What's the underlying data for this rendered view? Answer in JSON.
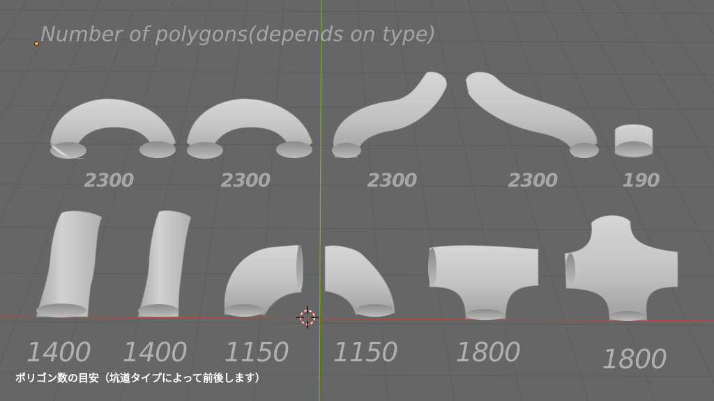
{
  "viewport": {
    "title": "Number of polygons(depends on type)",
    "caption": "ポリゴン数の目安（坑道タイプによって前後します）",
    "colors": {
      "background": "#666666",
      "grid_line": "#5d5d5d",
      "axis_y": "#7fa63a",
      "axis_x": "#b9483f",
      "mesh": "#c9c9c9",
      "label": "#a9a9a9"
    }
  },
  "labels": {
    "row1": [
      "2300",
      "2300",
      "2300",
      "2300",
      "190"
    ],
    "row2": [
      "1400",
      "1400",
      "1150",
      "1150",
      "1800",
      "1800"
    ]
  },
  "meshes": [
    {
      "name": "tunnel-arch-1",
      "icon": "arch-tube-shape"
    },
    {
      "name": "tunnel-arch-2",
      "icon": "arch-tube-shape"
    },
    {
      "name": "tunnel-s-curve-1",
      "icon": "s-curve-tube-shape"
    },
    {
      "name": "tunnel-s-curve-2",
      "icon": "s-curve-tube-shape"
    },
    {
      "name": "tunnel-short",
      "icon": "short-tube-shape"
    },
    {
      "name": "tunnel-straight-1",
      "icon": "straight-tube-shape"
    },
    {
      "name": "tunnel-straight-2",
      "icon": "straight-tube-shape"
    },
    {
      "name": "tunnel-elbow-1",
      "icon": "elbow-tube-shape"
    },
    {
      "name": "tunnel-elbow-2",
      "icon": "elbow-tube-shape"
    },
    {
      "name": "tunnel-t-junction",
      "icon": "t-junction-shape"
    },
    {
      "name": "tunnel-cross-junction",
      "icon": "cross-junction-shape"
    }
  ]
}
